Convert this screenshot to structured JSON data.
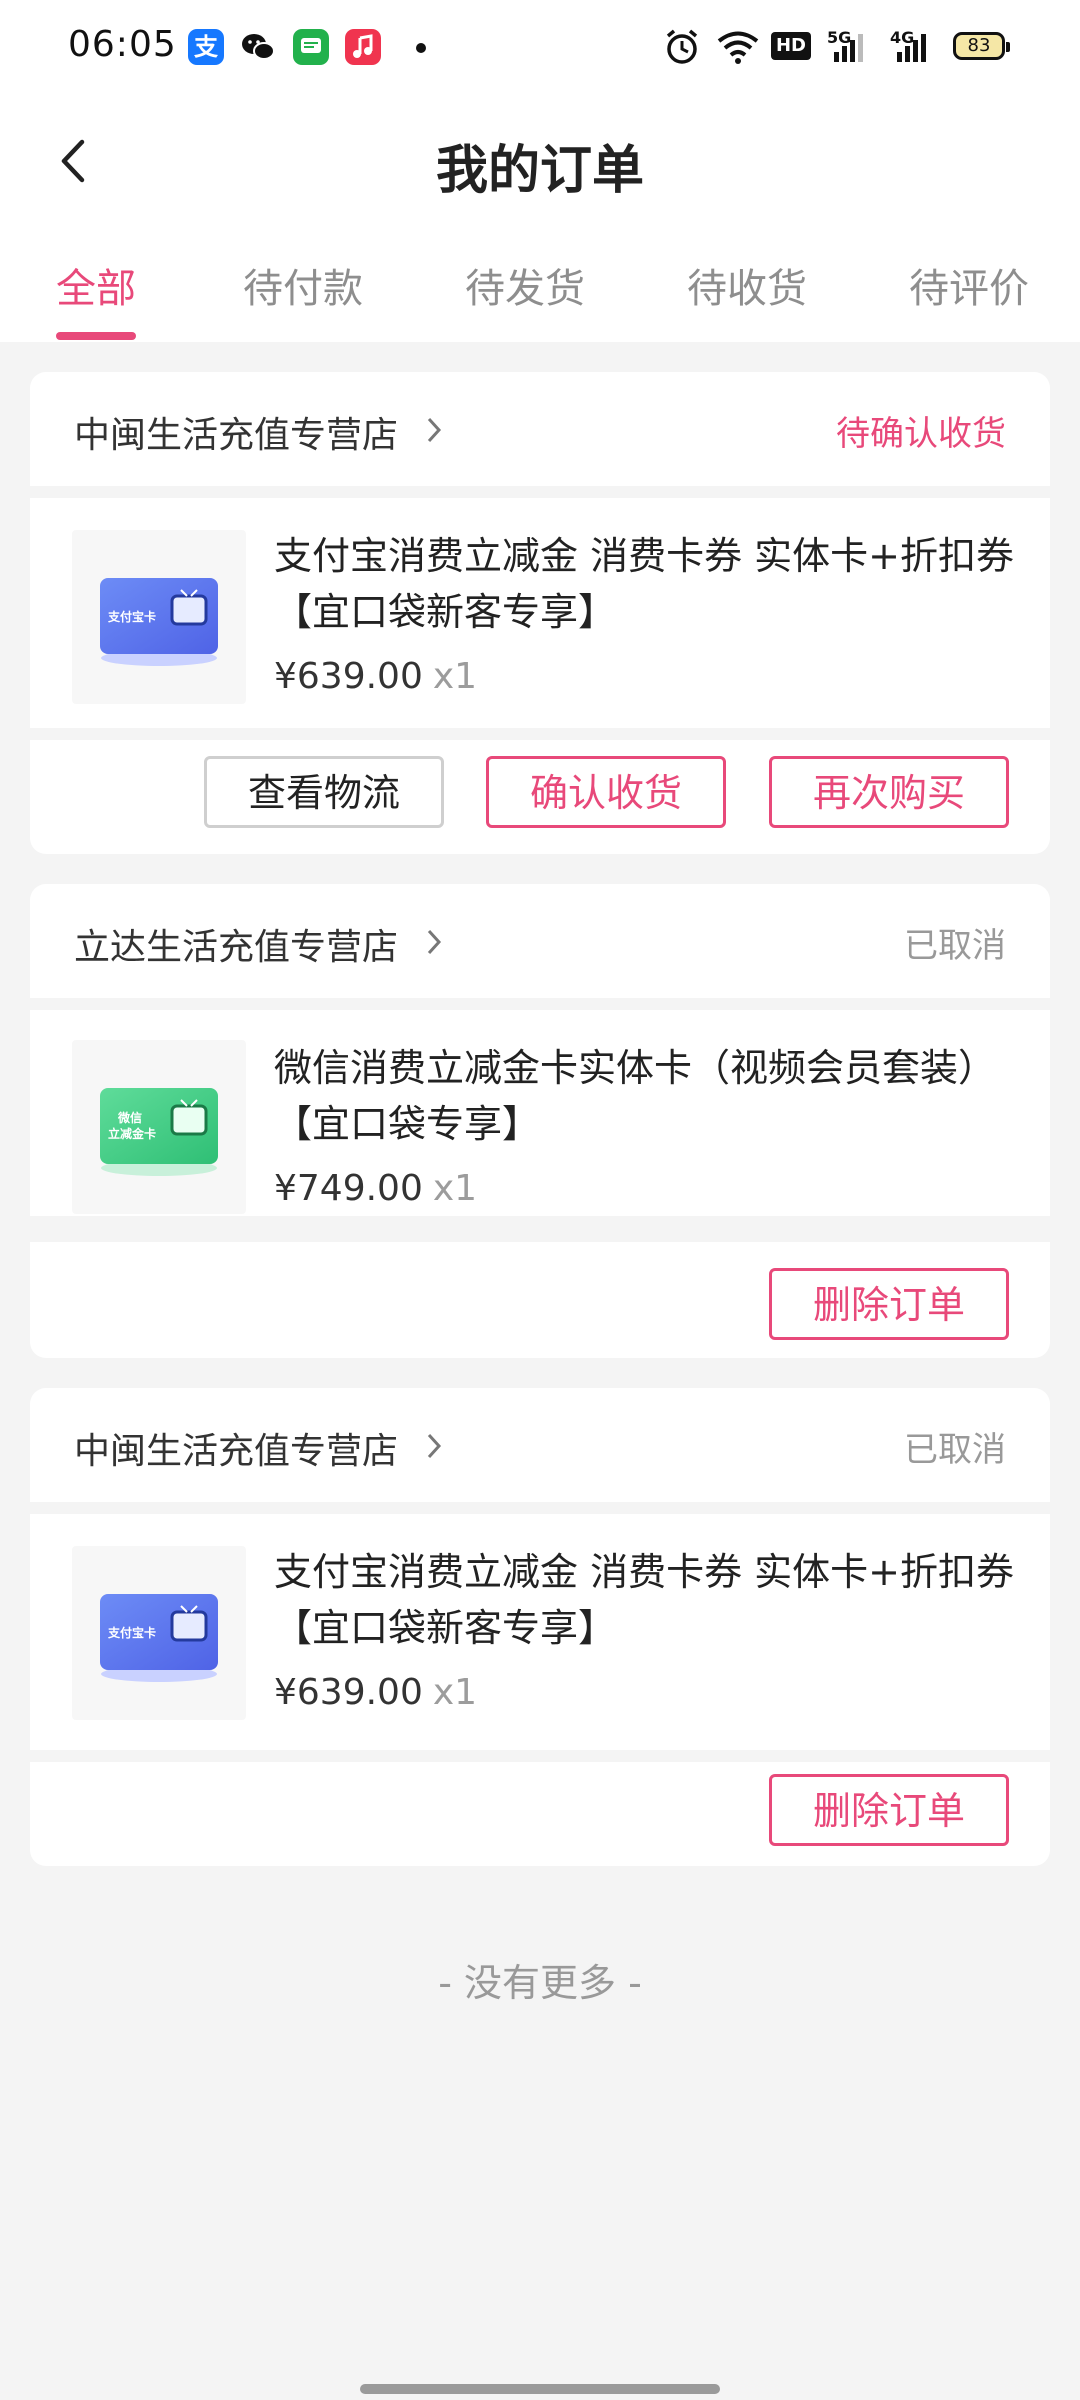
{
  "status_bar": {
    "time": "06:05",
    "app_icons": [
      "alipay-icon",
      "wechat-icon",
      "messages-icon",
      "music-icon"
    ],
    "alipay_glyph": "支",
    "network_hd": "HD",
    "net1": "5G",
    "net2": "4G",
    "battery": "83"
  },
  "header": {
    "title": "我的订单",
    "back_icon": "chevron-left-icon"
  },
  "tabs": [
    {
      "label": "全部",
      "active": true
    },
    {
      "label": "待付款"
    },
    {
      "label": "待发货"
    },
    {
      "label": "待收货"
    },
    {
      "label": "待评价"
    }
  ],
  "colors": {
    "accent": "#e8497a",
    "background": "#f4f4f4",
    "muted": "#999999"
  },
  "orders": [
    {
      "store": "中闽生活充值专营店",
      "status": "待确认收货",
      "product": {
        "name": "支付宝消费立减金 消费卡券 实体卡+折扣券【宜口袋新客专享】",
        "card_label": "支付宝卡",
        "price": "¥639.00",
        "qty": "x1"
      },
      "buttons": [
        "查看物流",
        "确认收货",
        "再次购买"
      ]
    },
    {
      "store": "立达生活充值专营店",
      "status": "已取消",
      "product": {
        "name": "微信消费立减金卡实体卡（视频会员套装）【宜口袋专享】",
        "card_label_1": "微信",
        "card_label_2": "立减金卡",
        "price": "¥749.00",
        "qty": "x1"
      },
      "buttons": [
        "删除订单"
      ]
    },
    {
      "store": "中闽生活充值专营店",
      "status": "已取消",
      "product": {
        "name": "支付宝消费立减金 消费卡券 实体卡+折扣券【宜口袋新客专享】",
        "card_label": "支付宝卡",
        "price": "¥639.00",
        "qty": "x1"
      },
      "buttons": [
        "删除订单"
      ]
    }
  ],
  "footer_text": "- 没有更多 -"
}
